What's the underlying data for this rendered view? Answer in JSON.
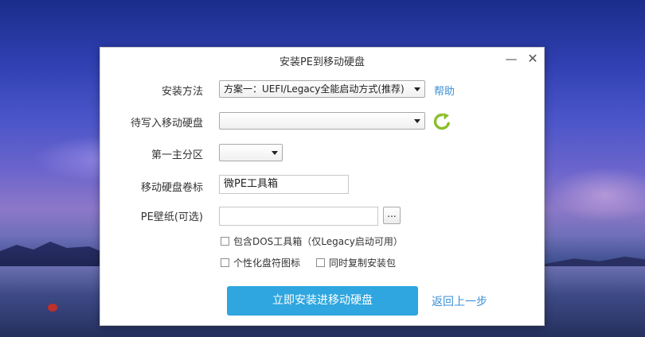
{
  "window": {
    "title": "安装PE到移动硬盘",
    "minimize": "—",
    "close": "✕"
  },
  "form": {
    "method_label": "安装方法",
    "method_value": "方案一：UEFI/Legacy全能启动方式(推荐)",
    "help_link": "帮助",
    "disk_label": "待写入移动硬盘",
    "disk_value": "",
    "partition_label": "第一主分区",
    "partition_value": "",
    "volume_label": "移动硬盘卷标",
    "volume_value": "微PE工具箱",
    "wallpaper_label": "PE壁纸(可选)",
    "wallpaper_value": "",
    "browse_label": "...",
    "opt_dos": "包含DOS工具箱（仅Legacy启动可用）",
    "opt_icon": "个性化盘符图标",
    "opt_copy": "同时复制安装包"
  },
  "actions": {
    "install": "立即安装进移动硬盘",
    "back": "返回上一步"
  },
  "colors": {
    "accent": "#2fa6df",
    "link": "#3a8fd6",
    "refresh": "#8bbf2a"
  }
}
